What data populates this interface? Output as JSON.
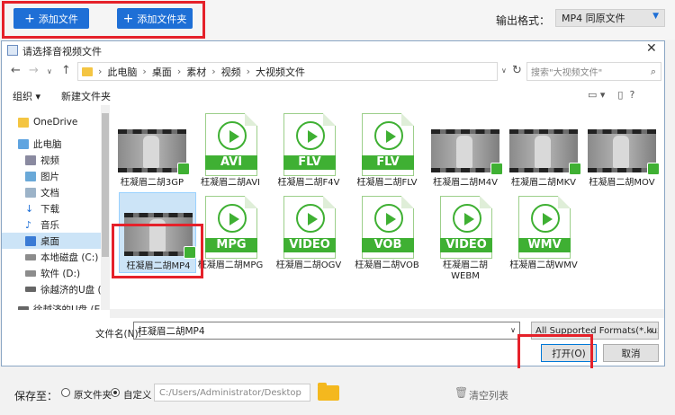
{
  "app": {
    "add_file": "添加文件",
    "add_folder": "添加文件夹",
    "format_label": "输出格式：",
    "format_value": "MP4  同原文件"
  },
  "dialog": {
    "title": "请选择音视频文件",
    "breadcrumb": [
      "此电脑",
      "桌面",
      "素材",
      "视频",
      "大视频文件"
    ],
    "search_placeholder": "搜索\"大视频文件\"",
    "organize": "组织 ▾",
    "new_folder": "新建文件夹",
    "nav": [
      {
        "label": "OneDrive",
        "icon": "folder-icon"
      },
      {
        "label": "此电脑",
        "icon": "computer-icon"
      },
      {
        "label": "视频",
        "icon": "video-folder-icon"
      },
      {
        "label": "图片",
        "icon": "picture-folder-icon"
      },
      {
        "label": "文档",
        "icon": "document-folder-icon"
      },
      {
        "label": "下载",
        "icon": "download-icon"
      },
      {
        "label": "音乐",
        "icon": "music-icon"
      },
      {
        "label": "桌面",
        "icon": "desktop-icon"
      },
      {
        "label": "本地磁盘 (C:)",
        "icon": "drive-icon"
      },
      {
        "label": "软件 (D:)",
        "icon": "drive-icon"
      },
      {
        "label": "徐越济的U盘 (E:",
        "icon": "usb-icon"
      },
      {
        "label": "徐越济的U盘 (E:",
        "icon": "usb-icon"
      }
    ],
    "files_row1": [
      {
        "label": "枉凝眉二胡3GP",
        "kind": "thumb"
      },
      {
        "label": "枉凝眉二胡AVI",
        "kind": "doc",
        "badge": "AVI"
      },
      {
        "label": "枉凝眉二胡F4V",
        "kind": "doc",
        "badge": "FLV"
      },
      {
        "label": "枉凝眉二胡FLV",
        "kind": "doc",
        "badge": "FLV"
      },
      {
        "label": "枉凝眉二胡M4V",
        "kind": "thumb"
      },
      {
        "label": "枉凝眉二胡MKV",
        "kind": "thumb"
      },
      {
        "label": "枉凝眉二胡MOV",
        "kind": "thumb"
      }
    ],
    "files_row2": [
      {
        "label": "枉凝眉二胡MP4",
        "kind": "thumb"
      },
      {
        "label": "枉凝眉二胡MPG",
        "kind": "doc",
        "badge": "MPG"
      },
      {
        "label": "枉凝眉二胡OGV",
        "kind": "doc",
        "badge": "VIDEO"
      },
      {
        "label": "枉凝眉二胡VOB",
        "kind": "doc",
        "badge": "VOB"
      },
      {
        "label": "枉凝眉二胡WEBM",
        "kind": "doc",
        "badge": "VIDEO"
      },
      {
        "label": "枉凝眉二胡WMV",
        "kind": "doc",
        "badge": "WMV"
      }
    ],
    "filename_label": "文件名(N):",
    "filename_value": "枉凝眉二胡MP4",
    "filter_value": "All Supported Formats(*.kux",
    "open_label": "打开(O)",
    "cancel_label": "取消"
  },
  "bottom": {
    "save_to": "保存至：",
    "radio_original": "原文件夹",
    "radio_custom": "自定义",
    "path": "C:/Users/Administrator/Desktop",
    "clear_list": "清空列表"
  },
  "colors": {
    "accent": "#1e6fd6",
    "highlight": "#e5212a",
    "file_green": "#3fb033"
  }
}
